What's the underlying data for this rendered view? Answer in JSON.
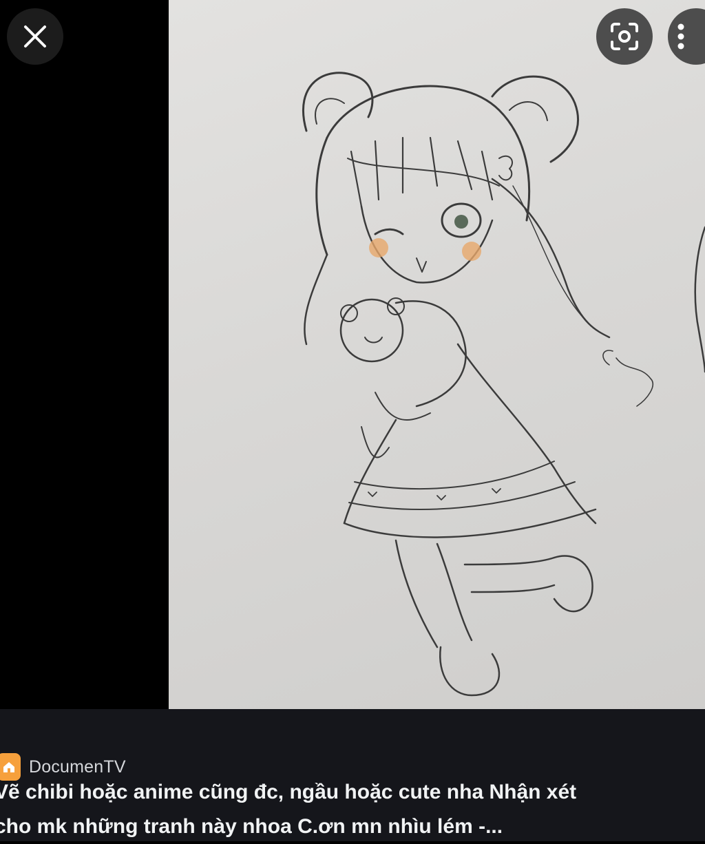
{
  "viewer": {
    "close_label": "Close",
    "lens_label": "Search inside image",
    "more_label": "More options"
  },
  "image": {
    "alt": "Vẽ chibi hoặc anime cũng đc, ngầu hoặc cute nha Nhận xét cho mk những tranh này nhoa C.ơn mn nhìu lém -..."
  },
  "source": {
    "name": "DocumenTV",
    "icon": "home-favicon",
    "favicon_color": "#f6a03c"
  },
  "title": {
    "line1": "Vẽ chibi hoặc anime cũng đc, ngầu hoặc cute nha Nhận xét",
    "line2": "cho mk những tranh này nhoa C.ơn mn nhìu lém -..."
  },
  "colors": {
    "caption_bg": "#15161b",
    "viewer_bg": "#000000"
  }
}
